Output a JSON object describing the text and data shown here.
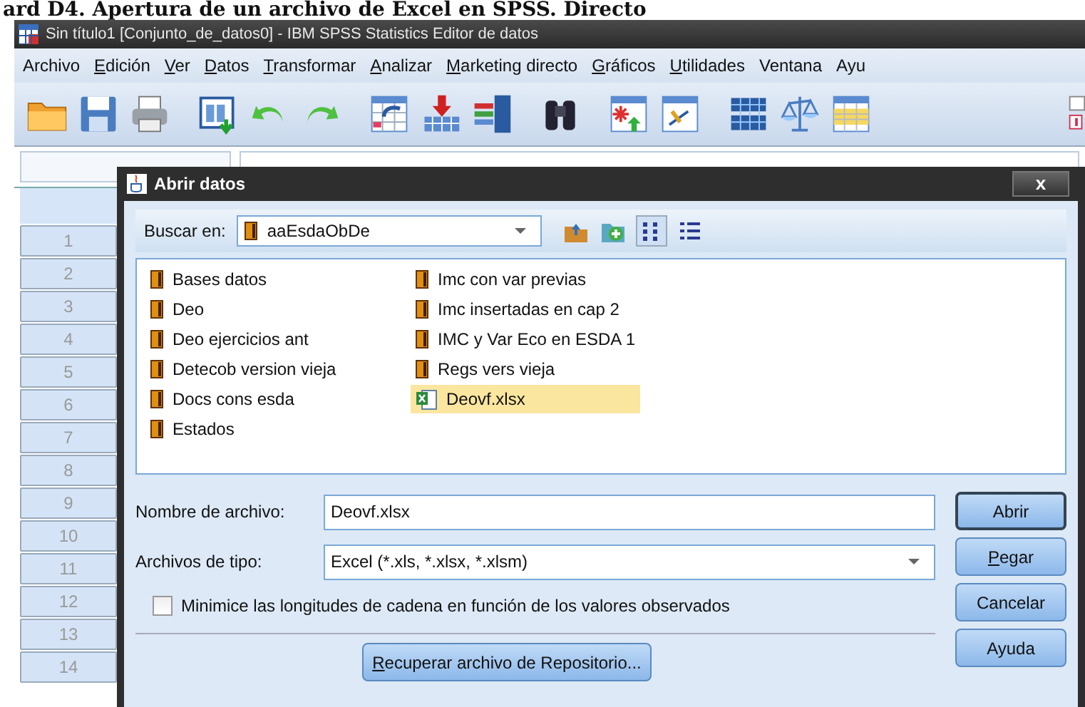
{
  "page_heading": "ard D4. Apertura de un archivo de Excel en SPSS. Directo",
  "window": {
    "title": "Sin título1 [Conjunto_de_datos0] - IBM SPSS Statistics Editor de datos"
  },
  "menu": [
    {
      "label": "Archivo",
      "mnemonic": false
    },
    {
      "label": "Edición",
      "mnemonic": true
    },
    {
      "label": "Ver",
      "mnemonic": true
    },
    {
      "label": "Datos",
      "mnemonic": true
    },
    {
      "label": "Transformar",
      "mnemonic": true
    },
    {
      "label": "Analizar",
      "mnemonic": true
    },
    {
      "label": "Marketing directo",
      "mnemonic": true
    },
    {
      "label": "Gráficos",
      "mnemonic": true
    },
    {
      "label": "Utilidades",
      "mnemonic": true
    },
    {
      "label": "Ventana",
      "mnemonic": false
    },
    {
      "label": "Ayu",
      "mnemonic": false
    }
  ],
  "row_numbers": [
    "1",
    "2",
    "3",
    "4",
    "5",
    "6",
    "7",
    "8",
    "9",
    "10",
    "11",
    "12",
    "13",
    "14"
  ],
  "dialog": {
    "title": "Abrir datos",
    "close": "x",
    "look_in_label": "Buscar en:",
    "look_in_value": "aaEsdaObDe",
    "files": [
      {
        "name": "Bases datos",
        "kind": "folder",
        "selected": false
      },
      {
        "name": "Deo",
        "kind": "folder",
        "selected": false
      },
      {
        "name": "Deo ejercicios ant",
        "kind": "folder",
        "selected": false
      },
      {
        "name": "Detecob version vieja",
        "kind": "folder",
        "selected": false
      },
      {
        "name": "Docs cons esda",
        "kind": "folder",
        "selected": false
      },
      {
        "name": "Estados",
        "kind": "folder",
        "selected": false
      },
      {
        "name": "Imc con var previas",
        "kind": "folder",
        "selected": false
      },
      {
        "name": "Imc insertadas en cap 2",
        "kind": "folder",
        "selected": false
      },
      {
        "name": "IMC y Var Eco en ESDA 1",
        "kind": "folder",
        "selected": false
      },
      {
        "name": "Regs vers vieja",
        "kind": "folder",
        "selected": false
      },
      {
        "name": "Deovf.xlsx",
        "kind": "excel",
        "selected": true
      }
    ],
    "file_name_label": "Nombre de archivo:",
    "file_name_value": "Deovf.xlsx",
    "file_type_label": "Archivos de tipo:",
    "file_type_value": "Excel (*.xls, *.xlsx, *.xlsm)",
    "checkbox": {
      "label": "Minimice las longitudes de cadena en función de los valores observados",
      "checked": false
    },
    "repository_button": {
      "label": "Recuperar archivo de Repositorio...",
      "mnemonic": true
    },
    "buttons": [
      {
        "label": "Abrir",
        "mnemonic": false
      },
      {
        "label": "Pegar",
        "mnemonic": true
      },
      {
        "label": "Cancelar",
        "mnemonic": false
      },
      {
        "label": "Ayuda",
        "mnemonic": false
      }
    ]
  }
}
